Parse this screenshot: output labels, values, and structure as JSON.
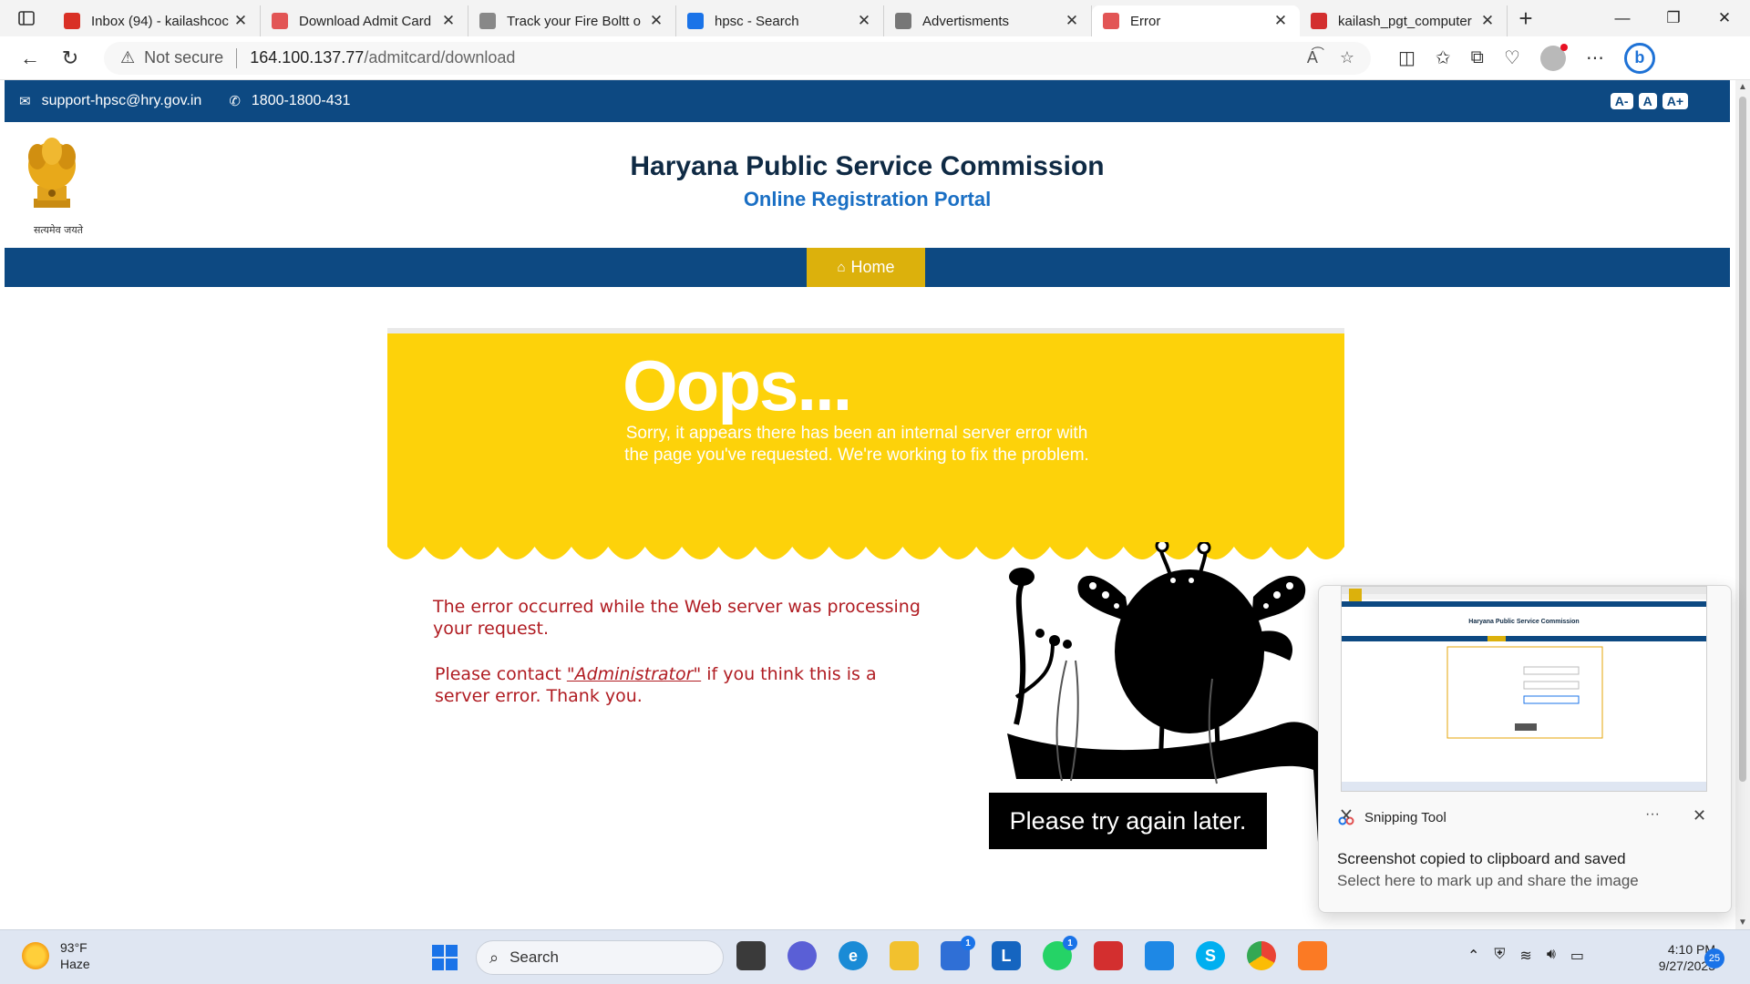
{
  "browser": {
    "tabs": [
      {
        "title": "Inbox (94) - kailashcoc",
        "icon": "gmail-icon",
        "color": "#d93025"
      },
      {
        "title": "Download Admit Card",
        "icon": "hpsc-logo-icon",
        "color": "#e25555"
      },
      {
        "title": "Track your Fire Boltt o",
        "icon": "bolt-icon",
        "color": "#888888"
      },
      {
        "title": "hpsc - Search",
        "icon": "search-icon",
        "color": "#1a73e8"
      },
      {
        "title": "Advertisments",
        "icon": "hpsc-logo-icon",
        "color": "#777777"
      },
      {
        "title": "Error",
        "icon": "hpsc-logo-icon",
        "color": "#e25555",
        "active": true
      },
      {
        "title": "kailash_pgt_computer",
        "icon": "pdf-icon",
        "color": "#d32f2f"
      }
    ],
    "address": {
      "security": "Not secure",
      "host": "164.100.137.77",
      "path": "/admitcard/download"
    }
  },
  "site": {
    "email": "support-hpsc@hry.gov.in",
    "phone": "1800-1800-431",
    "font_controls": [
      "A-",
      "A",
      "A+"
    ],
    "emblem_caption": "सत्यमेव जयते",
    "title": "Haryana Public Service Commission",
    "subtitle": "Online Registration Portal",
    "nav_home": "Home"
  },
  "error": {
    "heading": "Oops...",
    "sorry_text": "Sorry, it appears there has been an internal server error with the page you've requested. We're working to fix the problem.",
    "message": "The error occurred while the Web server was processing your request.",
    "contact_prefix": "Please contact ",
    "contact_link": "\"Administrator\"",
    "contact_suffix": " if you think this is a server error. Thank you.",
    "try_again": "Please try again later."
  },
  "toast": {
    "app": "Snipping Tool",
    "line1": "Screenshot copied to clipboard and saved",
    "line2": "Select here to mark up and share the image"
  },
  "taskbar": {
    "temp": "93°F",
    "weather": "Haze",
    "search": "Search",
    "time": "4:10 PM",
    "date": "9/27/2023",
    "notifications": "25",
    "badges": {
      "store": "1",
      "whatsapp": "1"
    }
  },
  "colors": {
    "header_blue": "#0d4982",
    "home_gold": "#dcb10c",
    "error_yellow": "#fdd20a",
    "error_red": "#b01c22"
  }
}
